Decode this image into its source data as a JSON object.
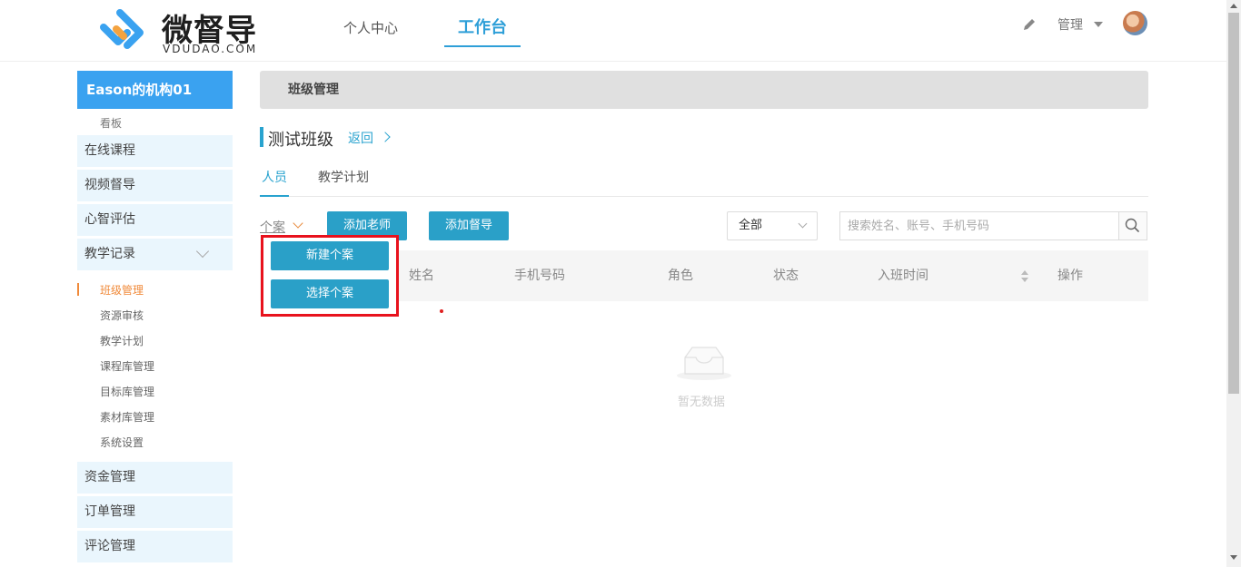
{
  "header": {
    "logo_text": "微督导",
    "logo_sub": "VDUDAO.COM",
    "nav": [
      {
        "label": "个人中心"
      },
      {
        "label": "工作台"
      }
    ],
    "manage_label": "管理"
  },
  "sidebar": {
    "org_name": "Eason的机构01",
    "kanban": "看板",
    "main_items": [
      {
        "label": "在线课程"
      },
      {
        "label": "视频督导"
      },
      {
        "label": "心智评估"
      },
      {
        "label": "教学记录"
      }
    ],
    "sub_items": [
      {
        "label": "班级管理",
        "active": true
      },
      {
        "label": "资源审核"
      },
      {
        "label": "教学计划"
      },
      {
        "label": "课程库管理"
      },
      {
        "label": "目标库管理"
      },
      {
        "label": "素材库管理"
      },
      {
        "label": "系统设置"
      }
    ],
    "bottom_items": [
      {
        "label": "资金管理"
      },
      {
        "label": "订单管理"
      },
      {
        "label": "评论管理"
      }
    ]
  },
  "main": {
    "breadcrumb": "班级管理",
    "class_title": "测试班级",
    "back_label": "返回",
    "tabs": [
      {
        "label": "人员",
        "active": true
      },
      {
        "label": "教学计划"
      }
    ],
    "case_label": "个案",
    "add_teacher": "添加老师",
    "add_supervisor": "添加督导",
    "filter_value": "全部",
    "search_placeholder": "搜索姓名、账号、手机号码",
    "columns": [
      "姓名",
      "手机号码",
      "角色",
      "状态",
      "入班时间",
      "操作"
    ],
    "empty_text": "暂无数据"
  },
  "dropdown": {
    "new_case": "新建个案",
    "select_case": "选择个案"
  },
  "colors": {
    "accent": "#2aa0c8",
    "brand_blue": "#3aa2f0",
    "highlight_border": "#e8121d",
    "active_orange": "#f08a3a"
  }
}
